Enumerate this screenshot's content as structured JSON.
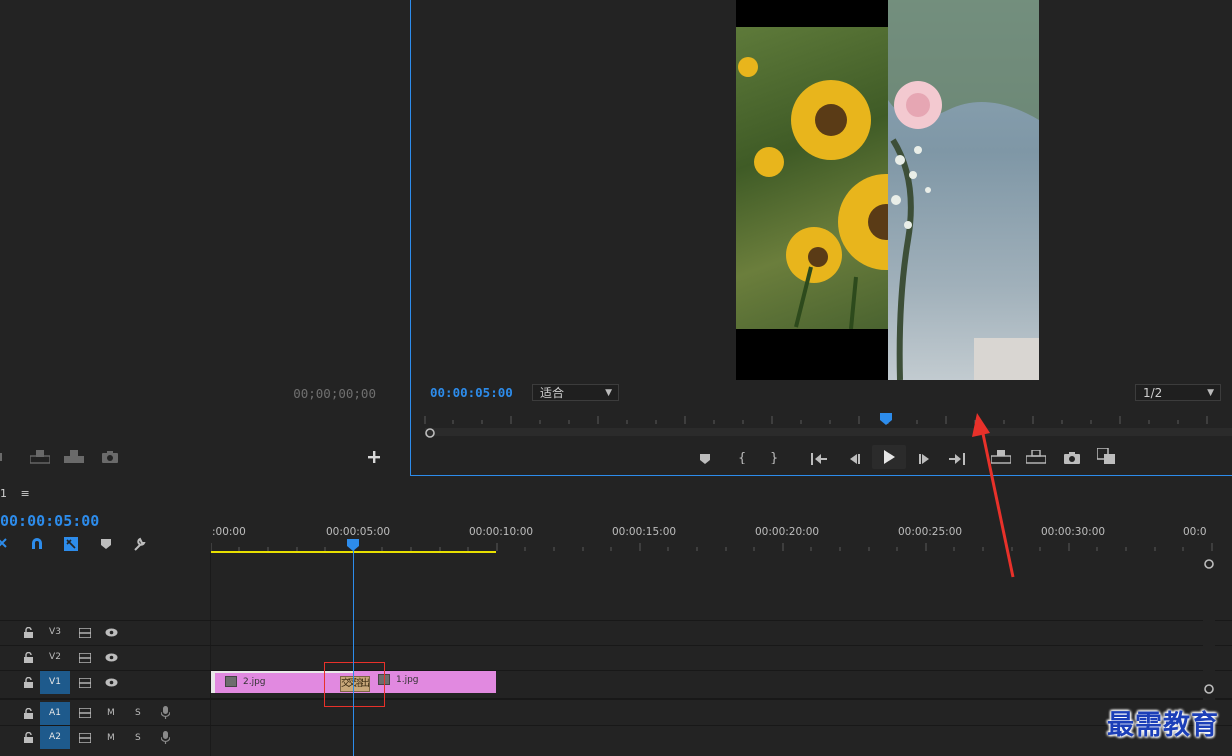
{
  "source_monitor": {
    "timecode": "00;00;00;00"
  },
  "program_monitor": {
    "timecode": "00:00:05:00",
    "fit_dropdown": "适合",
    "resolution_dropdown": "1/2"
  },
  "timeline": {
    "sequence_name": "1",
    "menu_glyph": "≡",
    "playhead_timecode": "00:00:05:00",
    "ruler_ticks": [
      ":00:00",
      "00:00:05:00",
      "00:00:10:00",
      "00:00:15:00",
      "00:00:20:00",
      "00:00:25:00",
      "00:00:30:00",
      "00:0"
    ],
    "tracks": {
      "v3": "V3",
      "v2": "V2",
      "v1": "V1",
      "a1": "A1",
      "a2": "A2",
      "mute": "M",
      "solo": "S"
    },
    "clips": {
      "clip_a": "2.jpg",
      "clip_b": "1.jpg",
      "transition_label": "交叉溶出"
    }
  },
  "watermark": "最需教育",
  "colors": {
    "accent_blue": "#2d8ceb",
    "clip_pink": "#e189e0",
    "work_area_yellow": "#e8e000",
    "annotation_red": "#e8312a"
  }
}
